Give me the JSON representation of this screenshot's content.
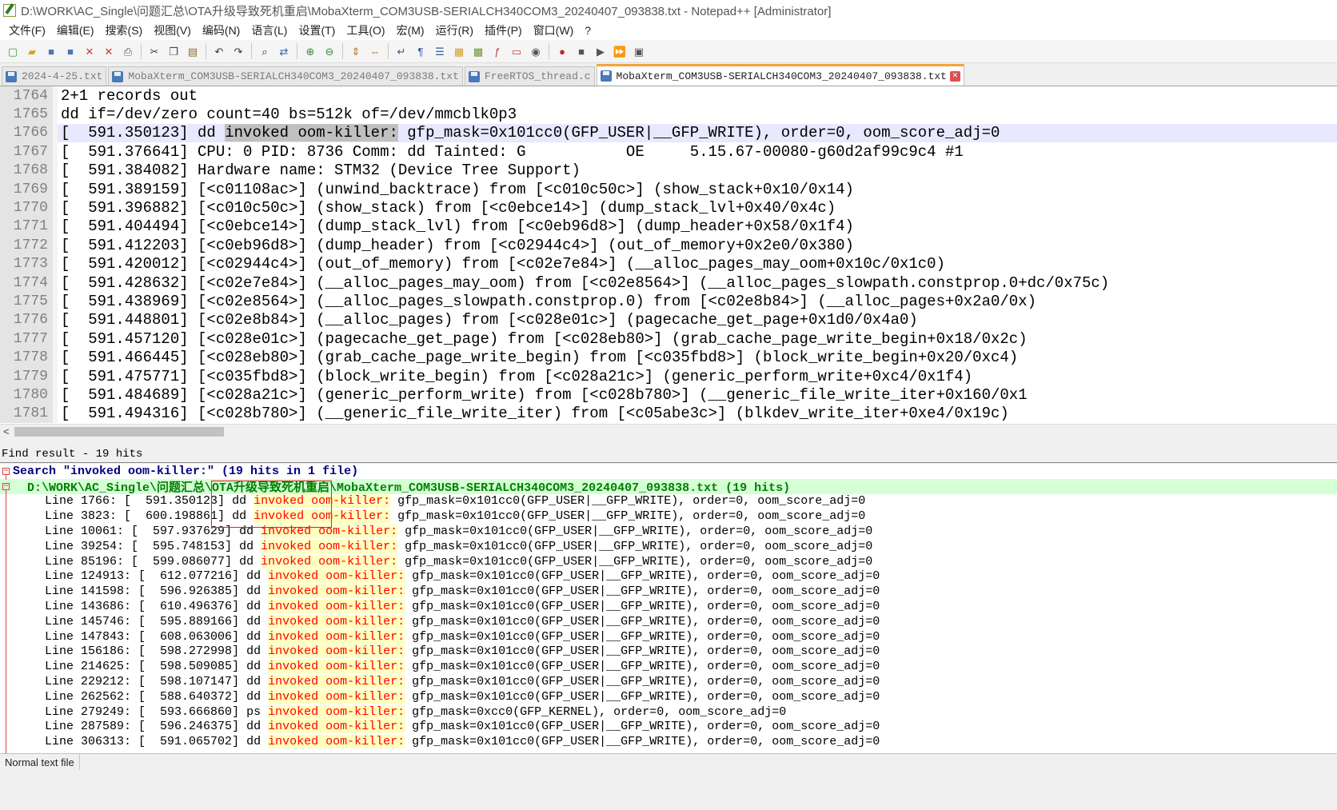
{
  "window": {
    "title": "D:\\WORK\\AC_Single\\问题汇总\\OTA升级导致死机重启\\MobaXterm_COM3USB-SERIALCH340COM3_20240407_093838.txt - Notepad++ [Administrator]"
  },
  "menu": [
    "文件(F)",
    "编辑(E)",
    "搜索(S)",
    "视图(V)",
    "编码(N)",
    "语言(L)",
    "设置(T)",
    "工具(O)",
    "宏(M)",
    "运行(R)",
    "插件(P)",
    "窗口(W)",
    "?"
  ],
  "toolbar": {
    "groups": [
      [
        {
          "icon": "new-file-icon",
          "glyph": "▢",
          "color": "#3a9a3a"
        },
        {
          "icon": "open-file-icon",
          "glyph": "▰",
          "color": "#d9a520"
        },
        {
          "icon": "save-icon",
          "glyph": "■",
          "color": "#4a78b8"
        },
        {
          "icon": "save-all-icon",
          "glyph": "■",
          "color": "#4a78b8"
        },
        {
          "icon": "close-icon",
          "glyph": "✕",
          "color": "#c04040"
        },
        {
          "icon": "close-all-icon",
          "glyph": "✕",
          "color": "#c04040"
        },
        {
          "icon": "print-icon",
          "glyph": "⎙",
          "color": "#555555"
        }
      ],
      [
        {
          "icon": "cut-icon",
          "glyph": "✂",
          "color": "#444444"
        },
        {
          "icon": "copy-icon",
          "glyph": "❐",
          "color": "#444444"
        },
        {
          "icon": "paste-icon",
          "glyph": "▤",
          "color": "#8a6a30"
        }
      ],
      [
        {
          "icon": "undo-icon",
          "glyph": "↶",
          "color": "#333333"
        },
        {
          "icon": "redo-icon",
          "glyph": "↷",
          "color": "#333333"
        }
      ],
      [
        {
          "icon": "find-icon",
          "glyph": "⌕",
          "color": "#333333"
        },
        {
          "icon": "replace-icon",
          "glyph": "⇄",
          "color": "#2a6ab0"
        }
      ],
      [
        {
          "icon": "zoom-in-icon",
          "glyph": "⊕",
          "color": "#3a8a3a"
        },
        {
          "icon": "zoom-out-icon",
          "glyph": "⊖",
          "color": "#3a8a3a"
        }
      ],
      [
        {
          "icon": "sync-vertical-icon",
          "glyph": "⇕",
          "color": "#c07020"
        },
        {
          "icon": "sync-horizontal-icon",
          "glyph": "⇔",
          "color": "#c07020"
        }
      ],
      [
        {
          "icon": "word-wrap-icon",
          "glyph": "↵",
          "color": "#2a5aa0"
        },
        {
          "icon": "show-all-chars-icon",
          "glyph": "¶",
          "color": "#2a5aa0"
        },
        {
          "icon": "indent-guide-icon",
          "glyph": "☰",
          "color": "#2a5aa0"
        },
        {
          "icon": "udl-icon",
          "glyph": "▦",
          "color": "#d0a020"
        },
        {
          "icon": "doc-map-icon",
          "glyph": "▩",
          "color": "#6a9a30"
        },
        {
          "icon": "function-list-icon",
          "glyph": "ƒ",
          "color": "#c04040"
        },
        {
          "icon": "folder-workspace-icon",
          "glyph": "▭",
          "color": "#c04040"
        },
        {
          "icon": "monitor-icon",
          "glyph": "◉",
          "color": "#555555"
        }
      ],
      [
        {
          "icon": "record-macro-icon",
          "glyph": "●",
          "color": "#d02020"
        },
        {
          "icon": "stop-macro-icon",
          "glyph": "■",
          "color": "#555555"
        },
        {
          "icon": "play-macro-icon",
          "glyph": "▶",
          "color": "#555555"
        },
        {
          "icon": "run-macro-multiple-icon",
          "glyph": "⏩",
          "color": "#2a5aa0"
        },
        {
          "icon": "save-macro-icon",
          "glyph": "▣",
          "color": "#555555"
        }
      ]
    ]
  },
  "tabs": [
    {
      "label": "2024-4-25.txt",
      "active": false
    },
    {
      "label": "MobaXterm_COM3USB-SERIALCH340COM3_20240407_093838.txt",
      "active": false
    },
    {
      "label": "FreeRTOS_thread.c",
      "active": false
    },
    {
      "label": "MobaXterm_COM3USB-SERIALCH340COM3_20240407_093838.txt",
      "active": true
    }
  ],
  "editor": {
    "current_line": 1766,
    "lines": [
      {
        "num": "1764",
        "text": "2+1 records out"
      },
      {
        "num": "1765",
        "text": "dd if=/dev/zero count=40 bs=512k of=/dev/mmcblk0p3"
      },
      {
        "num": "1766",
        "pre": "[  591.350123] dd ",
        "sel": "invoked oom-killer:",
        "post": " gfp_mask=0x101cc0(GFP_USER|__GFP_WRITE), order=0, oom_score_adj=0"
      },
      {
        "num": "1767",
        "text": "[  591.376641] CPU: 0 PID: 8736 Comm: dd Tainted: G           OE     5.15.67-00080-g60d2af99c9c4 #1"
      },
      {
        "num": "1768",
        "text": "[  591.384082] Hardware name: STM32 (Device Tree Support)"
      },
      {
        "num": "1769",
        "text": "[  591.389159] [<c01108ac>] (unwind_backtrace) from [<c010c50c>] (show_stack+0x10/0x14)"
      },
      {
        "num": "1770",
        "text": "[  591.396882] [<c010c50c>] (show_stack) from [<c0ebce14>] (dump_stack_lvl+0x40/0x4c)"
      },
      {
        "num": "1771",
        "text": "[  591.404494] [<c0ebce14>] (dump_stack_lvl) from [<c0eb96d8>] (dump_header+0x58/0x1f4)"
      },
      {
        "num": "1772",
        "text": "[  591.412203] [<c0eb96d8>] (dump_header) from [<c02944c4>] (out_of_memory+0x2e0/0x380)"
      },
      {
        "num": "1773",
        "text": "[  591.420012] [<c02944c4>] (out_of_memory) from [<c02e7e84>] (__alloc_pages_may_oom+0x10c/0x1c0)"
      },
      {
        "num": "1774",
        "text": "[  591.428632] [<c02e7e84>] (__alloc_pages_may_oom) from [<c02e8564>] (__alloc_pages_slowpath.constprop.0+dc/0x75c)"
      },
      {
        "num": "1775",
        "text": "[  591.438969] [<c02e8564>] (__alloc_pages_slowpath.constprop.0) from [<c02e8b84>] (__alloc_pages+0x2a0/0x)"
      },
      {
        "num": "1776",
        "text": "[  591.448801] [<c02e8b84>] (__alloc_pages) from [<c028e01c>] (pagecache_get_page+0x1d0/0x4a0)"
      },
      {
        "num": "1777",
        "text": "[  591.457120] [<c028e01c>] (pagecache_get_page) from [<c028eb80>] (grab_cache_page_write_begin+0x18/0x2c)"
      },
      {
        "num": "1778",
        "text": "[  591.466445] [<c028eb80>] (grab_cache_page_write_begin) from [<c035fbd8>] (block_write_begin+0x20/0xc4)"
      },
      {
        "num": "1779",
        "text": "[  591.475771] [<c035fbd8>] (block_write_begin) from [<c028a21c>] (generic_perform_write+0xc4/0x1f4)"
      },
      {
        "num": "1780",
        "text": "[  591.484689] [<c028a21c>] (generic_perform_write) from [<c028b780>] (__generic_file_write_iter+0x160/0x1"
      },
      {
        "num": "1781",
        "text": "[  591.494316] [<c028b780>] (__generic_file_write_iter) from [<c05abe3c>] (blkdev_write_iter+0xe4/0x19c)"
      }
    ]
  },
  "find_panel": {
    "title": "Find result - 19 hits",
    "search_line": "Search \"invoked oom-killer:\" (19 hits in 1 file)",
    "file_line": "D:\\WORK\\AC_Single\\问题汇总\\OTA升级导致死机重启\\MobaXterm_COM3USB-SERIALCH340COM3_20240407_093838.txt (19 hits)",
    "keyword": "invoked oom-killer:",
    "hits": [
      {
        "line": "1766",
        "ts": "591.350123",
        "cmd": "dd",
        "rest": " gfp_mask=0x101cc0(GFP_USER|__GFP_WRITE), order=0, oom_score_adj=0"
      },
      {
        "line": "3823",
        "ts": "600.198861",
        "cmd": "dd",
        "rest": " gfp_mask=0x101cc0(GFP_USER|__GFP_WRITE), order=0, oom_score_adj=0"
      },
      {
        "line": "10061",
        "ts": "597.937629",
        "cmd": "dd",
        "rest": " gfp_mask=0x101cc0(GFP_USER|__GFP_WRITE), order=0, oom_score_adj=0"
      },
      {
        "line": "39254",
        "ts": "595.748153",
        "cmd": "dd",
        "rest": " gfp_mask=0x101cc0(GFP_USER|__GFP_WRITE), order=0, oom_score_adj=0"
      },
      {
        "line": "85196",
        "ts": "599.086077",
        "cmd": "dd",
        "rest": " gfp_mask=0x101cc0(GFP_USER|__GFP_WRITE), order=0, oom_score_adj=0"
      },
      {
        "line": "124913",
        "ts": "612.077216",
        "cmd": "dd",
        "rest": " gfp_mask=0x101cc0(GFP_USER|__GFP_WRITE), order=0, oom_score_adj=0"
      },
      {
        "line": "141598",
        "ts": "596.926385",
        "cmd": "dd",
        "rest": " gfp_mask=0x101cc0(GFP_USER|__GFP_WRITE), order=0, oom_score_adj=0"
      },
      {
        "line": "143686",
        "ts": "610.496376",
        "cmd": "dd",
        "rest": " gfp_mask=0x101cc0(GFP_USER|__GFP_WRITE), order=0, oom_score_adj=0"
      },
      {
        "line": "145746",
        "ts": "595.889166",
        "cmd": "dd",
        "rest": " gfp_mask=0x101cc0(GFP_USER|__GFP_WRITE), order=0, oom_score_adj=0"
      },
      {
        "line": "147843",
        "ts": "608.063006",
        "cmd": "dd",
        "rest": " gfp_mask=0x101cc0(GFP_USER|__GFP_WRITE), order=0, oom_score_adj=0"
      },
      {
        "line": "156186",
        "ts": "598.272998",
        "cmd": "dd",
        "rest": " gfp_mask=0x101cc0(GFP_USER|__GFP_WRITE), order=0, oom_score_adj=0"
      },
      {
        "line": "214625",
        "ts": "598.509085",
        "cmd": "dd",
        "rest": " gfp_mask=0x101cc0(GFP_USER|__GFP_WRITE), order=0, oom_score_adj=0"
      },
      {
        "line": "229212",
        "ts": "598.107147",
        "cmd": "dd",
        "rest": " gfp_mask=0x101cc0(GFP_USER|__GFP_WRITE), order=0, oom_score_adj=0"
      },
      {
        "line": "262562",
        "ts": "588.640372",
        "cmd": "dd",
        "rest": " gfp_mask=0x101cc0(GFP_USER|__GFP_WRITE), order=0, oom_score_adj=0"
      },
      {
        "line": "279249",
        "ts": "593.666860",
        "cmd": "ps",
        "rest": " gfp_mask=0xcc0(GFP_KERNEL), order=0, oom_score_adj=0"
      },
      {
        "line": "287589",
        "ts": "596.246375",
        "cmd": "dd",
        "rest": " gfp_mask=0x101cc0(GFP_USER|__GFP_WRITE), order=0, oom_score_adj=0"
      },
      {
        "line": "306313",
        "ts": "591.065702",
        "cmd": "dd",
        "rest": " gfp_mask=0x101cc0(GFP_USER|__GFP_WRITE), order=0, oom_score_adj=0"
      }
    ]
  },
  "status": {
    "doc_type": "Normal text file"
  },
  "colors": {
    "active_tab_accent": "#f2a33a",
    "keyword_fg": "#ff0000",
    "keyword_bg": "#ffffbf",
    "file_line_bg": "#d5ffd5",
    "annotation": "#e02020"
  }
}
